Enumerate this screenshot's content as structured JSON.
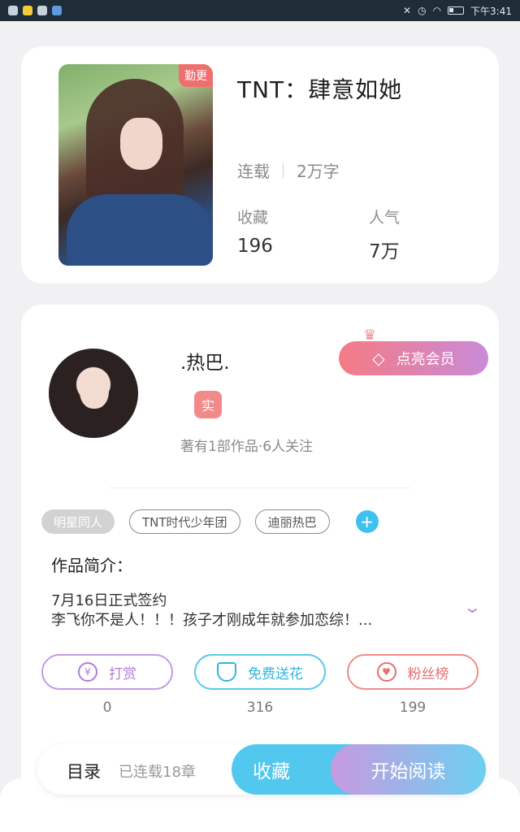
{
  "status_bar": {
    "time": "下午3:41"
  },
  "book": {
    "badge": "勤更",
    "title": "TNT：肆意如她",
    "status": "连载",
    "word_count": "2万字",
    "favorites_label": "收藏",
    "favorites_value": "196",
    "popularity_label": "人气",
    "popularity_value": "7万"
  },
  "author": {
    "name": ".热巴.",
    "verified_badge": "实",
    "works_info": "著有1部作品·6人关注",
    "vip_button": "点亮会员"
  },
  "tags": [
    "明星同人",
    "TNT时代少年团",
    "迪丽热巴"
  ],
  "intro": {
    "title": "作品简介：",
    "line1": "7月16日正式签约",
    "line2": "李飞你不是人！！！孩子才刚成年就参加恋综！..."
  },
  "actions": [
    {
      "label": "打赏",
      "count": "0",
      "icon": "yen-coin-icon"
    },
    {
      "label": "免费送花",
      "count": "316",
      "icon": "flower-icon"
    },
    {
      "label": "粉丝榜",
      "count": "199",
      "icon": "fan-rank-icon"
    }
  ],
  "bottom_bar": {
    "toc_label": "目录",
    "toc_info": "已连载18章",
    "favorite_button": "收藏",
    "read_button": "开始阅读"
  },
  "colors": {
    "accent_blue": "#53c8ee",
    "accent_pink": "#f57b84",
    "accent_purple": "#c79ae0",
    "badge_red": "#ef6f6f"
  }
}
